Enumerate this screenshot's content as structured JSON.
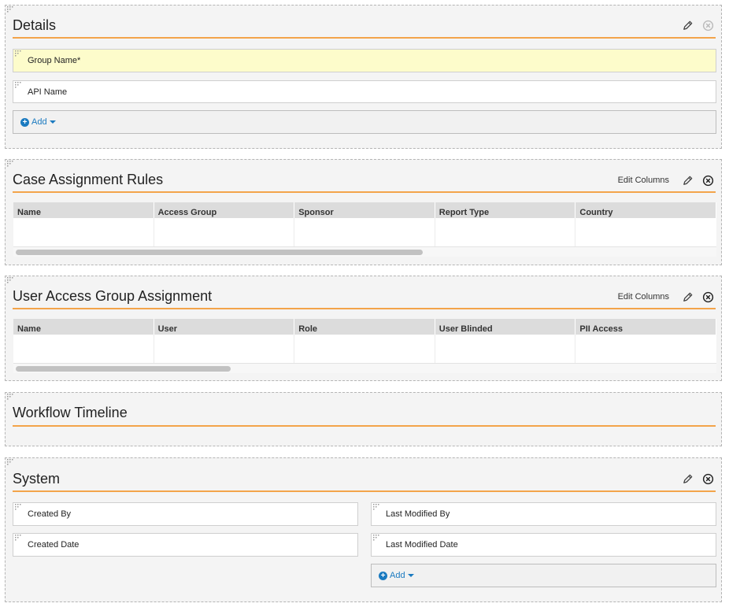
{
  "details": {
    "title": "Details",
    "fields": {
      "group_name": "Group Name*",
      "api_name": "API Name"
    },
    "add_label": "Add"
  },
  "case_rules": {
    "title": "Case Assignment Rules",
    "edit_columns": "Edit Columns",
    "columns": [
      "Name",
      "Access Group",
      "Sponsor",
      "Report Type",
      "Country"
    ]
  },
  "user_access": {
    "title": "User Access Group Assignment",
    "edit_columns": "Edit Columns",
    "columns": [
      "Name",
      "User",
      "Role",
      "User Blinded",
      "PII Access"
    ]
  },
  "workflow": {
    "title": "Workflow Timeline"
  },
  "system": {
    "title": "System",
    "fields": {
      "created_by": "Created By",
      "last_modified_by": "Last Modified By",
      "created_date": "Created Date",
      "last_modified_date": "Last Modified Date"
    },
    "add_label": "Add"
  },
  "icons": {
    "edit": "pencil-icon",
    "remove": "close-circle-icon",
    "add": "plus-circle-icon",
    "dropdown": "caret-down-icon",
    "drag": "drag-grip-icon"
  },
  "colors": {
    "accent": "#f3a44a",
    "link": "#1a7ac0",
    "required_bg": "#fdfccb"
  }
}
